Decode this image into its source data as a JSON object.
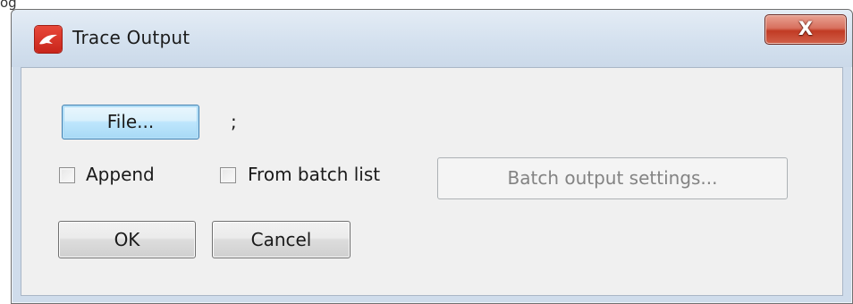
{
  "background": {
    "partial_text": "og"
  },
  "window": {
    "title": "Trace Output",
    "close_label": "X"
  },
  "dialog": {
    "file_button_label": "File...",
    "file_path_value": ";",
    "append": {
      "label": "Append",
      "checked": false
    },
    "from_batch_list": {
      "label": "From batch list",
      "checked": false
    },
    "batch_output_settings_label": "Batch output settings...",
    "ok_label": "OK",
    "cancel_label": "Cancel"
  },
  "colors": {
    "app_icon": "#d3342a",
    "close_button": "#c94a35",
    "dialog_face": "#f0f0f0",
    "focused_button": "#a7d9f5"
  }
}
